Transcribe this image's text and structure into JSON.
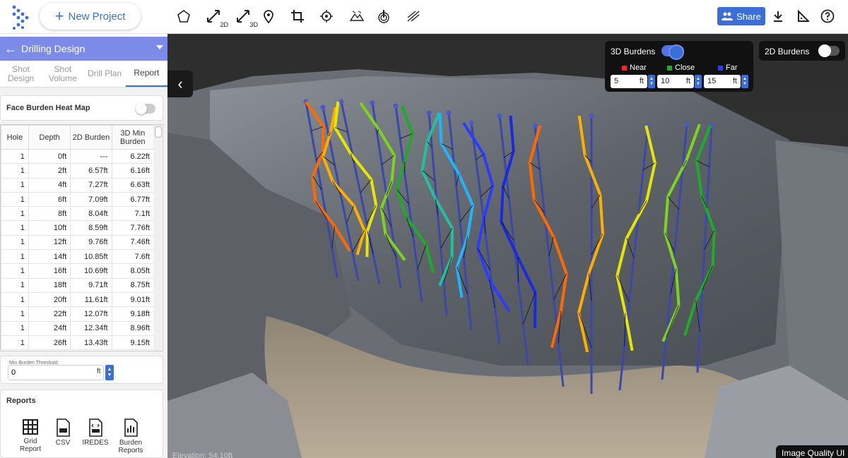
{
  "toolbar": {
    "new_project_label": "New Project",
    "tools": [
      {
        "icon": "polygon-icon",
        "sub": ""
      },
      {
        "icon": "measure-2d-icon",
        "sub": "2D"
      },
      {
        "icon": "measure-3d-icon",
        "sub": "3D"
      },
      {
        "icon": "map-pin-icon",
        "sub": ""
      },
      {
        "icon": "crop-icon",
        "sub": ""
      },
      {
        "icon": "target-icon",
        "sub": ""
      },
      {
        "icon": "terrain-icon",
        "sub": ""
      },
      {
        "icon": "drill-icon",
        "sub": ""
      },
      {
        "icon": "blast-icon",
        "sub": ""
      }
    ],
    "share_label": "Share"
  },
  "sidebar": {
    "title": "Drilling Design",
    "tabs": [
      {
        "label": "Shot Design",
        "active": false
      },
      {
        "label": "Shot Volume",
        "active": false
      },
      {
        "label": "Drill Plan",
        "active": false
      },
      {
        "label": "Report",
        "active": true
      }
    ],
    "heatmap_label": "Face Burden Heat Map",
    "table": {
      "headers": [
        "Hole",
        "Depth",
        "2D Burden",
        "3D Min Burden"
      ],
      "rows": [
        [
          "1",
          "0ft",
          "---",
          "6.22ft"
        ],
        [
          "1",
          "2ft",
          "6.57ft",
          "6.16ft"
        ],
        [
          "1",
          "4ft",
          "7.27ft",
          "6.63ft"
        ],
        [
          "1",
          "6ft",
          "7.09ft",
          "6.77ft"
        ],
        [
          "1",
          "8ft",
          "8.04ft",
          "7.1ft"
        ],
        [
          "1",
          "10ft",
          "8.59ft",
          "7.76ft"
        ],
        [
          "1",
          "12ft",
          "9.76ft",
          "7.46ft"
        ],
        [
          "1",
          "14ft",
          "10.85ft",
          "7.6ft"
        ],
        [
          "1",
          "16ft",
          "10.69ft",
          "8.05ft"
        ],
        [
          "1",
          "18ft",
          "9.71ft",
          "8.75ft"
        ],
        [
          "1",
          "20ft",
          "11.61ft",
          "9.01ft"
        ],
        [
          "1",
          "22ft",
          "12.07ft",
          "9.18ft"
        ],
        [
          "1",
          "24ft",
          "12.34ft",
          "8.96ft"
        ],
        [
          "1",
          "26ft",
          "13.43ft",
          "9.15ft"
        ]
      ]
    },
    "threshold": {
      "label": "Min Burden Threshold",
      "value": "0",
      "unit": "ft"
    },
    "reports": {
      "title": "Reports",
      "items": [
        {
          "label": "Grid Report",
          "icon": "grid-report-icon"
        },
        {
          "label": "CSV",
          "icon": "csv-file-icon"
        },
        {
          "label": "IREDES",
          "icon": "xml-file-icon"
        },
        {
          "label": "Burden Reports",
          "icon": "burden-report-icon"
        }
      ]
    }
  },
  "burdens3d": {
    "title": "3D Burdens",
    "enabled": true,
    "legend": [
      {
        "label": "Near",
        "color": "#ff2020",
        "value": "5",
        "unit": "ft"
      },
      {
        "label": "Close",
        "color": "#1faa2a",
        "value": "10",
        "unit": "ft"
      },
      {
        "label": "Far",
        "color": "#2b3cff",
        "value": "15",
        "unit": "ft"
      }
    ]
  },
  "burdens2d": {
    "title": "2D Burdens",
    "enabled": false
  },
  "viewport": {
    "image_quality_label": "Image Quality UI",
    "elevation_label": "Elevation: 54.10ft"
  }
}
